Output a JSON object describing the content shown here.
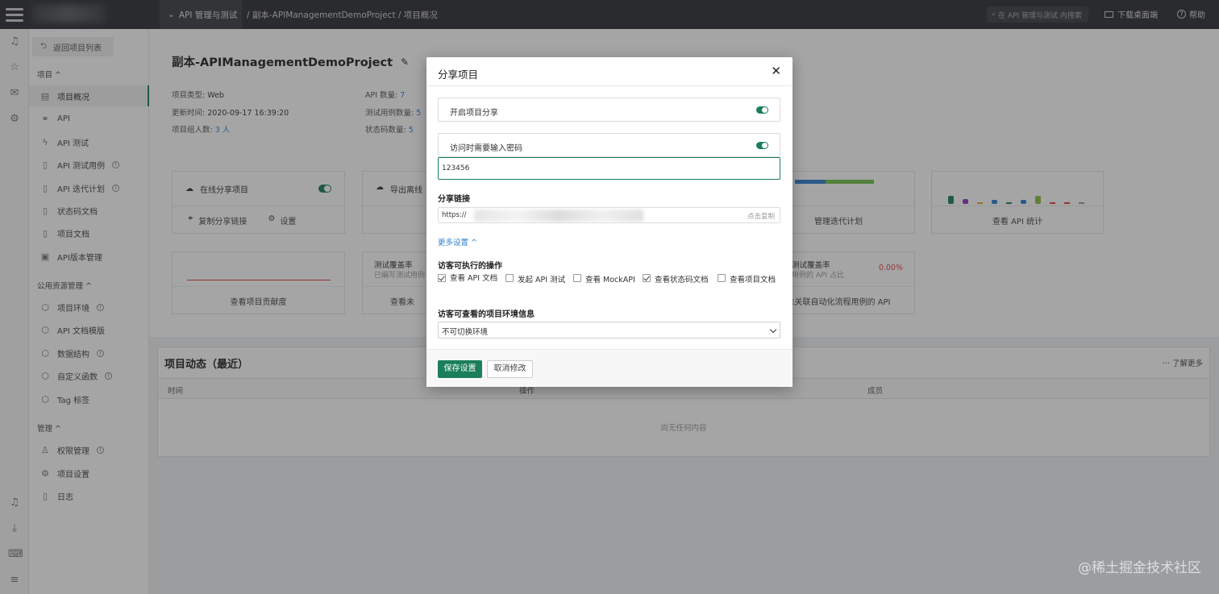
{
  "topbar": {
    "section_label": "API 管理与测试",
    "breadcrumb": "/ 副本-APIManagementDemoProject / 项目概况",
    "search_placeholder": "在 API 管理与测试 内搜索",
    "download_label": "下载桌面端",
    "help_label": "帮助"
  },
  "sidebar": {
    "back_label": "返回项目列表",
    "group_project": "项目 ^",
    "items_project": [
      {
        "label": "项目概况",
        "icon": "dashboard-icon"
      },
      {
        "label": "API",
        "icon": "link-icon"
      },
      {
        "label": "API 测试",
        "icon": "lightning-icon"
      },
      {
        "label": "API 测试用例",
        "icon": "doc-icon",
        "info": true
      },
      {
        "label": "API 迭代计划",
        "icon": "doc-icon",
        "info": true
      },
      {
        "label": "状态码文档",
        "icon": "doc-icon"
      },
      {
        "label": "项目文档",
        "icon": "doc-icon"
      },
      {
        "label": "API版本管理",
        "icon": "version-icon"
      }
    ],
    "group_public": "公用资源管理 ^",
    "items_public": [
      {
        "label": "项目环境",
        "icon": "cube-icon",
        "info": true
      },
      {
        "label": "API 文档模版",
        "icon": "cube-icon"
      },
      {
        "label": "数据结构",
        "icon": "cube-icon",
        "info": true
      },
      {
        "label": "自定义函数",
        "icon": "cube-icon",
        "info": true
      },
      {
        "label": "Tag 标签",
        "icon": "cube-icon"
      }
    ],
    "group_manage": "管理 ^",
    "items_manage": [
      {
        "label": "权限管理",
        "icon": "user-icon",
        "info": true
      },
      {
        "label": "项目设置",
        "icon": "gear-icon"
      },
      {
        "label": "日志",
        "icon": "doc-icon"
      }
    ]
  },
  "project": {
    "title": "副本-APIManagementDemoProject",
    "type_label": "项目类型:",
    "type_value": "Web",
    "updated_label": "更新时间:",
    "updated_value": "2020-09-17 16:39:20",
    "members_label": "项目组人数:",
    "members_value": "3 人",
    "api_count_label": "API 数量:",
    "api_count_value": "7",
    "testcase_label": "测试用例数量:",
    "testcase_value": "5",
    "status_label": "状态码数量:",
    "status_value": "5"
  },
  "cards": {
    "share_label": "在线分享项目",
    "copy_link": "复制分享链接",
    "settings": "设置",
    "export_label": "导出离线",
    "iteration": "管理迭代计划",
    "api_stats": "查看 API 统计",
    "contrib": "查看项目贡献度",
    "coverage_title": "测试覆盖率",
    "coverage_sub": "已编写测试用例",
    "view_prefix": "查看未",
    "coverage_title2": "测试覆盖率",
    "coverage_sub2": "用例的 API 占比",
    "coverage_pct": "0.00%",
    "auto_link": "未关联自动化流程用例的 API"
  },
  "activity": {
    "title": "项目动态（最近）",
    "more": "了解更多",
    "col_time": "时间",
    "col_op": "操作",
    "col_member": "成员",
    "empty": "尚无任何内容"
  },
  "modal": {
    "title": "分享项目",
    "enable_share": "开启项目分享",
    "require_password": "访问时需要输入密码",
    "password_value": "123456",
    "share_link_label": "分享链接",
    "link_prefix": "https://",
    "copy_label": "点击复制",
    "more_settings": "更多设置 ^",
    "visitor_ops_label": "访客可执行的操作",
    "ops": [
      {
        "label": "查看 API 文档",
        "checked": true
      },
      {
        "label": "发起 API 测试",
        "checked": false
      },
      {
        "label": "查看 MockAPI",
        "checked": false
      },
      {
        "label": "查看状态码文档",
        "checked": true
      },
      {
        "label": "查看项目文档",
        "checked": false
      }
    ],
    "env_label": "访客可查看的项目环境信息",
    "env_value": "不可切换环境",
    "save": "保存设置",
    "cancel": "取消修改"
  },
  "watermark": "@稀土掘金技术社区",
  "colors": {
    "accent": "#1a7f5a",
    "link": "#2d7fcf",
    "topbar": "#2b2e33"
  }
}
